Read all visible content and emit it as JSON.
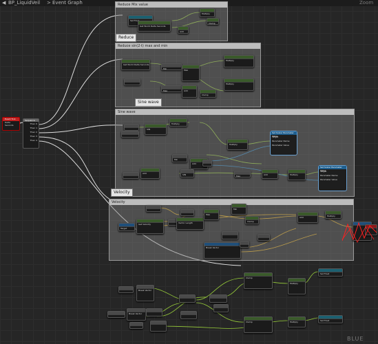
{
  "window": {
    "tab_title": "BP_LiquidVeil",
    "separator": ">",
    "graph_name": "Event Graph",
    "zoom_label": "Zoom"
  },
  "comments": [
    {
      "id": "reduce",
      "header": "Reduce Mix value",
      "label": "Reduce"
    },
    {
      "id": "sine-out",
      "header": "Reduce sin(2·t) max and min",
      "label": "Sine wave"
    },
    {
      "id": "sine",
      "header": "Sine wave",
      "label": ""
    },
    {
      "id": "velocity",
      "header": "Velocity",
      "label": "Velocity"
    }
  ],
  "event_node": {
    "title": "Event Tick",
    "delta_label": "Delta Seconds"
  },
  "sequence_node": {
    "title": "Sequence",
    "pins": [
      "Then 0",
      "Then 1",
      "Then 2",
      "Then 3",
      "Then 4"
    ]
  },
  "big_nodes": [
    {
      "id": "set-scalar-1",
      "title": "Set Scalar Parameter Value",
      "target": "Target",
      "param": "Parameter Name",
      "value": "Parameter Value"
    },
    {
      "id": "set-scalar-2",
      "title": "Set Scalar Parameter Value",
      "target": "Target",
      "param": "Parameter Name",
      "value": "Parameter Value"
    }
  ],
  "small_nodes": {
    "world_delta": "Get World Delta Seconds",
    "make_struct": "Return Value",
    "get_velocity": "Get Velocity",
    "vector_length": "Vector Length",
    "multiply": "Multiply",
    "sin": "SIN",
    "add": "Add",
    "min": "Min",
    "max": "Max",
    "clamp": "Clamp",
    "break_vector": "Break Vector",
    "set_float": "Set Float",
    "target": "Target"
  },
  "watermark": "BLUE",
  "colors": {
    "exec_wire": "#ffffff",
    "float_wire": "#9ad03a",
    "vector_wire": "#e8b020",
    "object_wire": "#2f8fd0",
    "comment_header": "#bdbdbd",
    "comment_fill": "#8a8a8a",
    "event_red": "#c02020",
    "error_red": "#ff2020"
  }
}
